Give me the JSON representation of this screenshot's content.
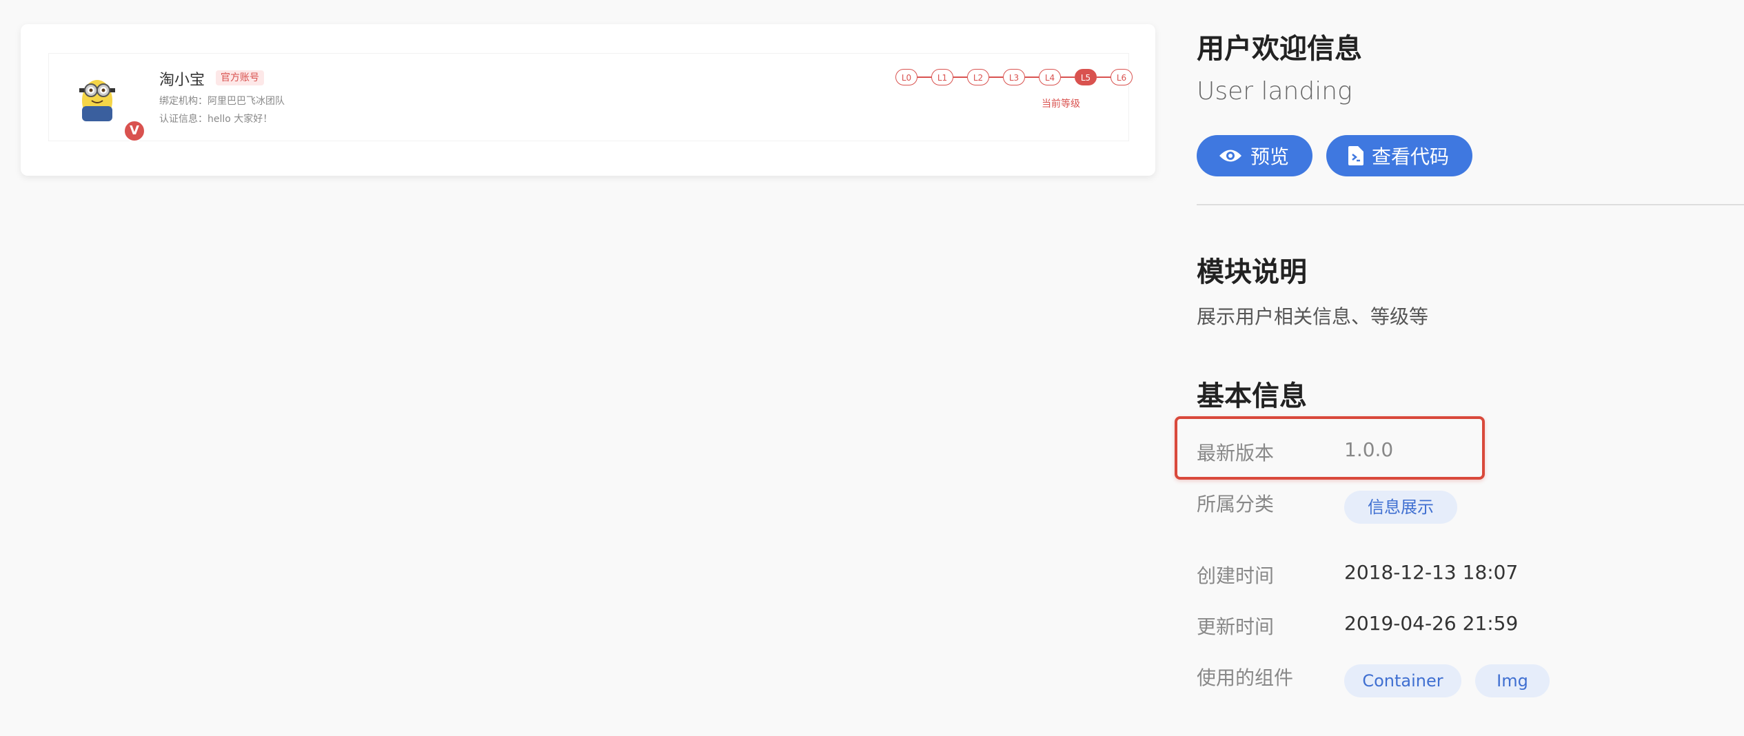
{
  "preview": {
    "user_name": "淘小宝",
    "official_tag": "官方账号",
    "org_line": "绑定机构：阿里巴巴飞冰团队",
    "cert_line": "认证信息：hello 大家好！",
    "badge": "V",
    "levels": [
      "L0",
      "L1",
      "L2",
      "L3",
      "L4",
      "L5",
      "L6"
    ],
    "current_level": "L5",
    "current_level_label": "当前等级",
    "accent_color": "#d9524f"
  },
  "panel": {
    "title": "用户欢迎信息",
    "subtitle": "User landing",
    "buttons": {
      "preview_label": "预览",
      "code_label": "查看代码"
    },
    "module_section": {
      "title": "模块说明",
      "description": "展示用户相关信息、等级等"
    },
    "basic_section": {
      "title": "基本信息",
      "version_label": "最新版本",
      "version_value": "1.0.0",
      "category_label": "所属分类",
      "category_value": "信息展示",
      "created_label": "创建时间",
      "created_value": "2018-12-13 18:07",
      "updated_label": "更新时间",
      "updated_value": "2019-04-26 21:59",
      "components_label": "使用的组件",
      "components": [
        "Container",
        "Img"
      ]
    },
    "accent_color": "#3f78e0"
  }
}
